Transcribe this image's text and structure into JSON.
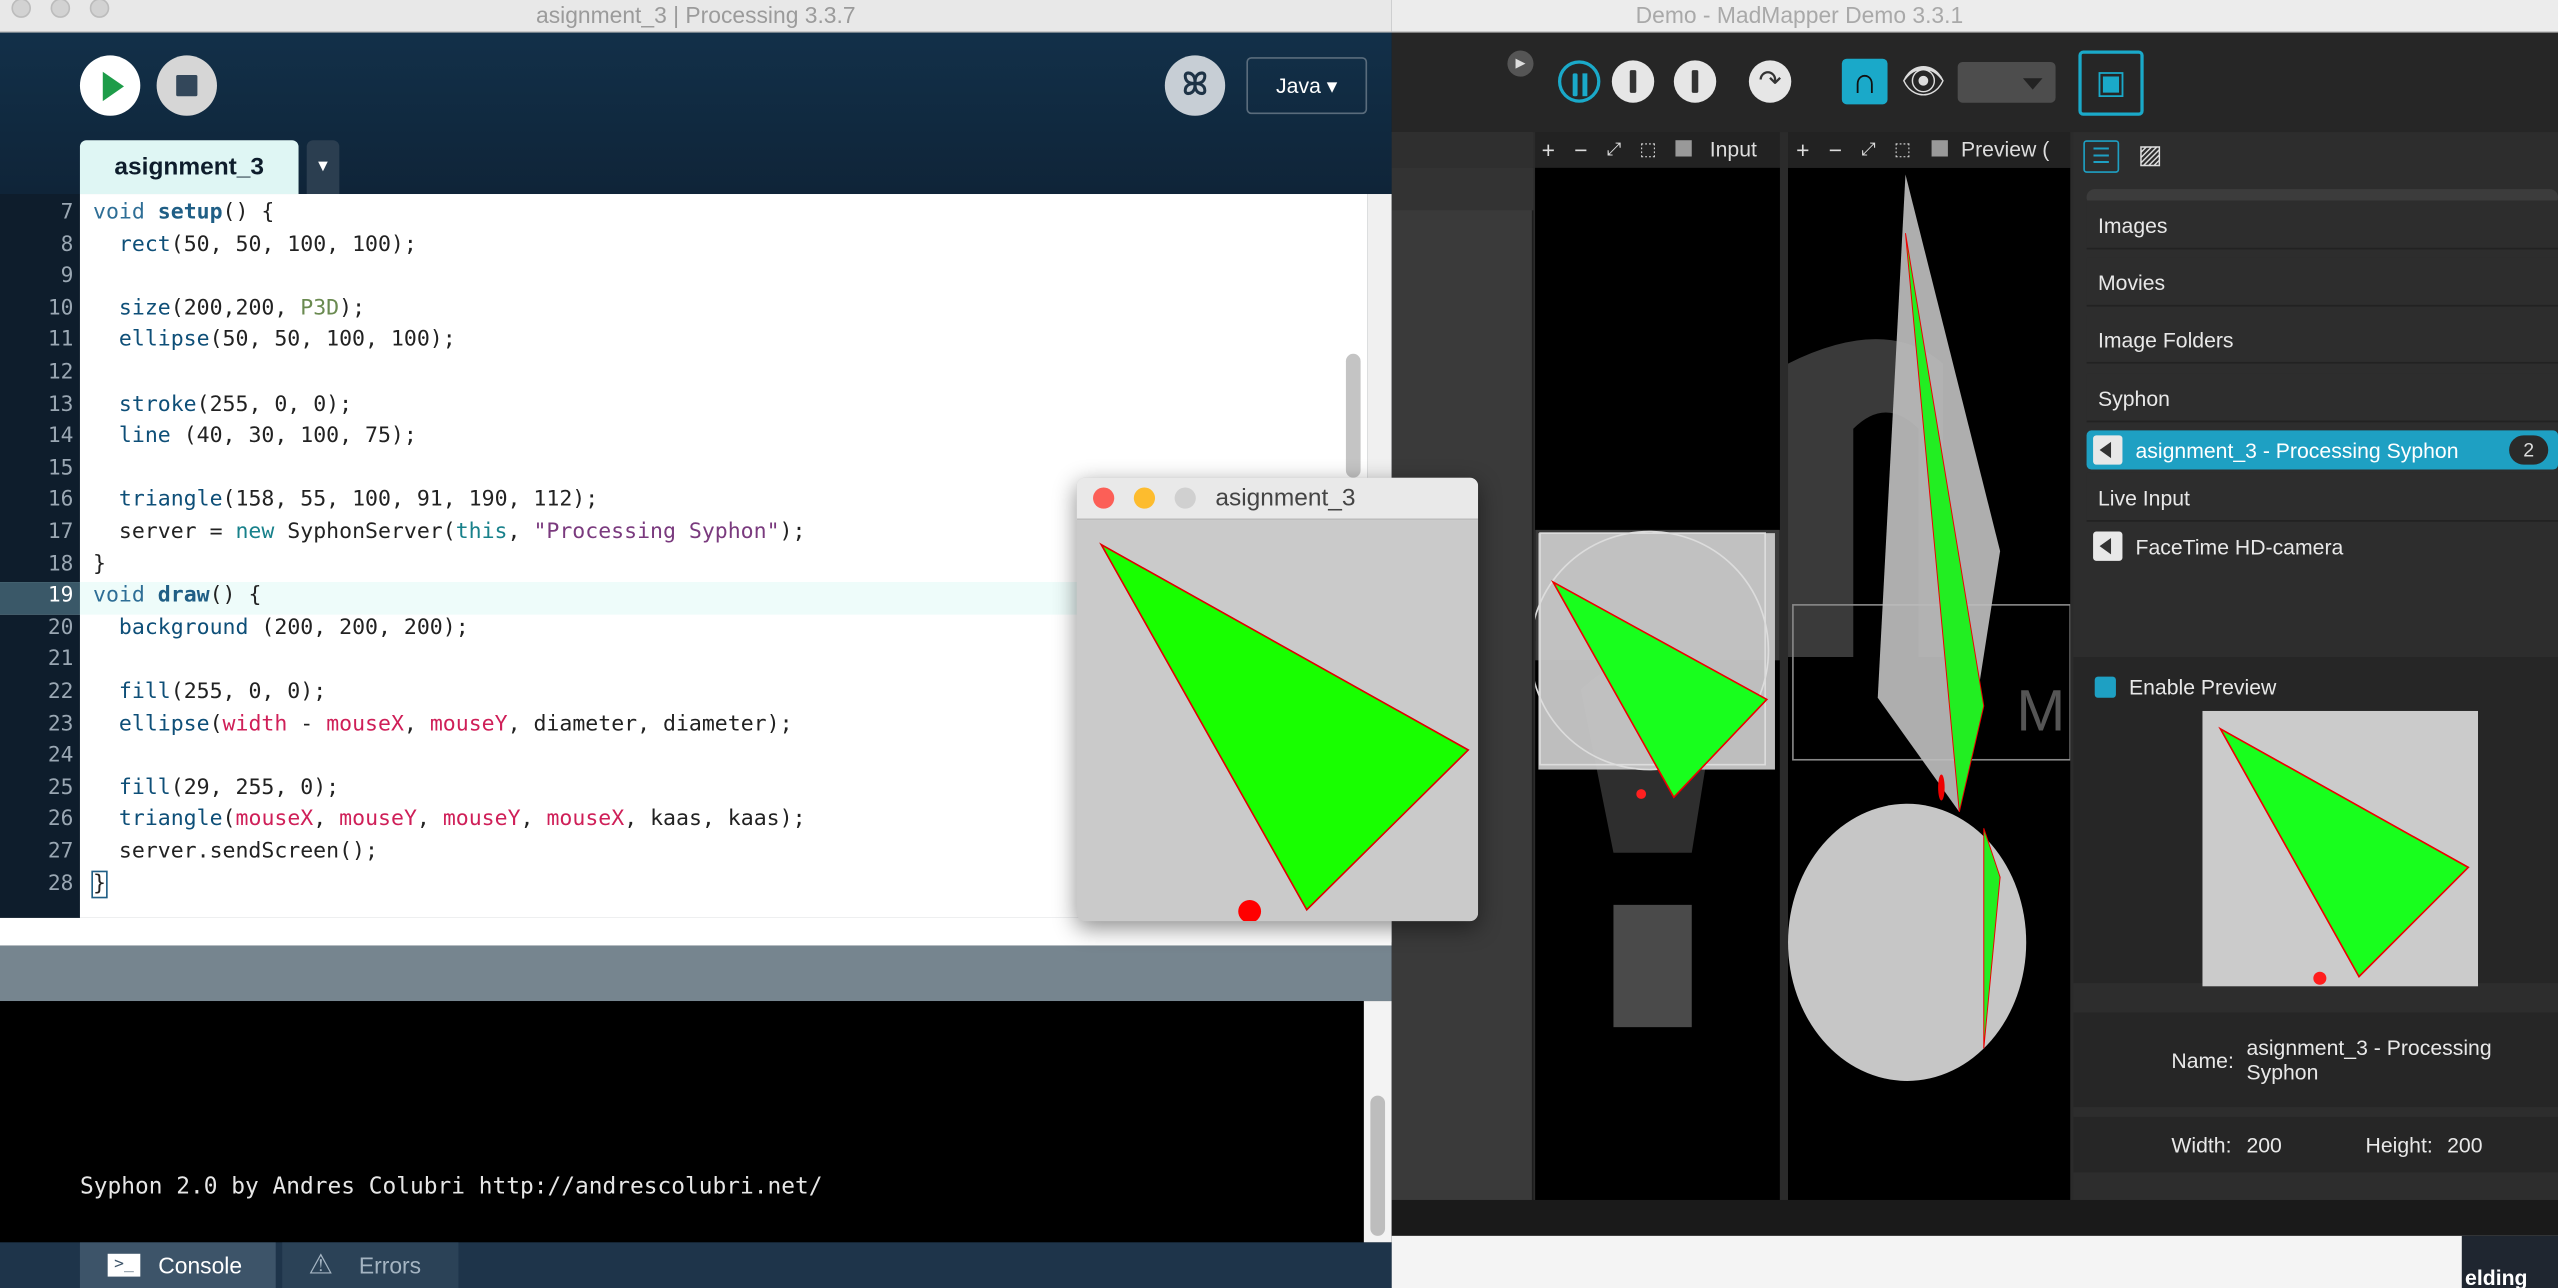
{
  "mm": {
    "title": "Demo - MadMapper Demo 3.3.1",
    "input_label": "Input",
    "preview_label": "Preview (",
    "sections": [
      "Images",
      "Movies",
      "Image Folders",
      "Syphon"
    ],
    "syphon_item": "asignment_3 - Processing Syphon",
    "syphon_badge": "2",
    "live_input": "Live Input",
    "facetime": "FaceTime HD-camera",
    "enable_preview": "Enable Preview",
    "name_label": "Name:",
    "name_value1": "asignment_3 - Processing",
    "name_value2": "Syphon",
    "width_label": "Width:",
    "width_value": "200",
    "height_label": "Height:",
    "height_value": "200",
    "bg_text": "elding"
  },
  "pr": {
    "title": "asignment_3 | Processing 3.3.7",
    "mode": "Java ▾",
    "tab": "asignment_3",
    "tab_dd": "▼",
    "debug_glyph": "ꕤ",
    "lines": [
      "7",
      "8",
      "9",
      "10",
      "11",
      "12",
      "13",
      "14",
      "15",
      "16",
      "17",
      "18",
      "19",
      "20",
      "21",
      "22",
      "23",
      "24",
      "25",
      "26",
      "27",
      "28"
    ],
    "console_msg": "Syphon 2.0 by Andres Colubri http://andrescolubri.net/",
    "console_tab": "Console",
    "errors_tab": "Errors"
  },
  "sketch": {
    "title": "asignment_3"
  },
  "icons": {
    "play": "play-icon",
    "stop": "stop-icon",
    "pause": "pause-icon",
    "eye": "eye-icon",
    "magnet": "magnet-icon",
    "doc": "document-icon"
  },
  "colors": {
    "accent": "#1ea0c3",
    "green": "#00ff00",
    "red": "#e00000",
    "run": "#1e9c49"
  }
}
